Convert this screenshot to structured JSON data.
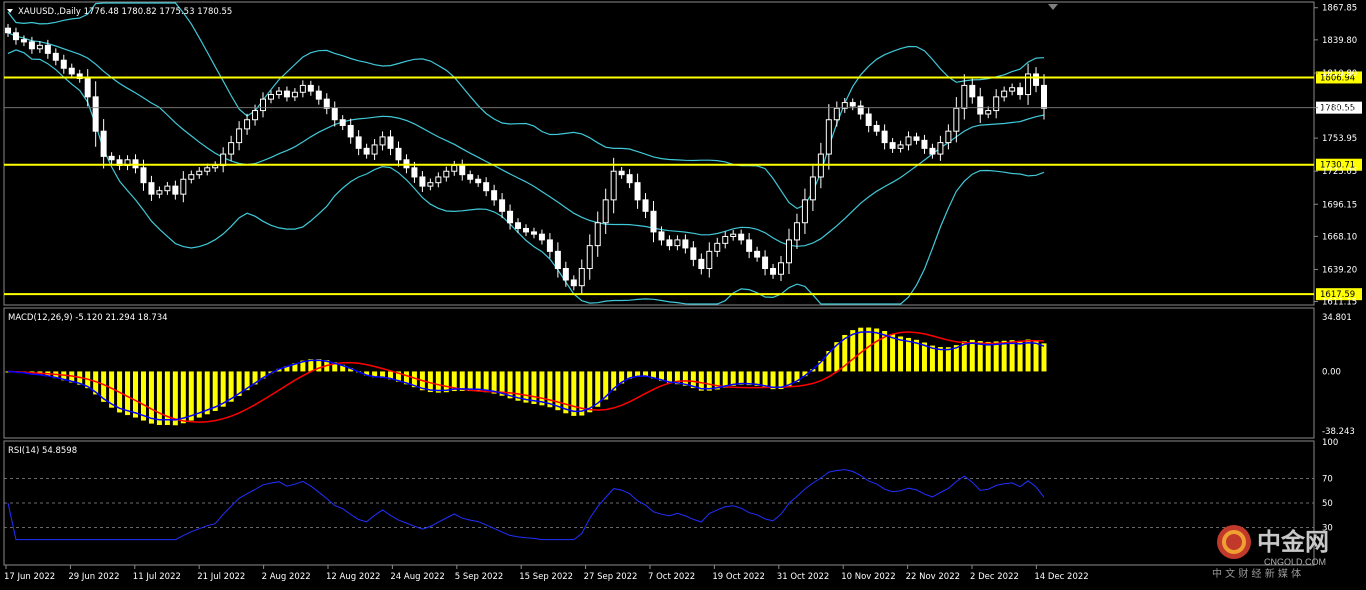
{
  "header": {
    "main_title": "XAUUSD.,Daily  1776.48 1780.82 1775.53 1780.55",
    "macd_title": "MACD(12,26,9) -5.120 21.294 18.734",
    "rsi_title": "RSI(14) 54.8598"
  },
  "colors": {
    "background": "#000000",
    "candle": "#ffffff",
    "bollinger": "#40c8d8",
    "hline": "#ffff00",
    "macd_hist": "#ffff00",
    "macd_main": "#0000ff",
    "macd_signal": "#ff0000",
    "rsi_line": "#2030ff"
  },
  "price_axis": {
    "ticks": [
      "1867.85",
      "1839.80",
      "1810.80",
      "1780.55",
      "1753.95",
      "1725.05",
      "1696.15",
      "1668.10",
      "1639.20",
      "1611.15"
    ],
    "tick_values": [
      1867.85,
      1839.8,
      1810.8,
      1780.55,
      1753.95,
      1725.05,
      1696.15,
      1668.1,
      1639.2,
      1611.15
    ],
    "range": [
      1609,
      1872
    ]
  },
  "horizontal_levels": [
    {
      "label": "1806.94",
      "value": 1806.94
    },
    {
      "label": "1730.71",
      "value": 1730.71
    },
    {
      "label": "1617.59",
      "value": 1617.59
    }
  ],
  "current_price": {
    "label": "1780.55",
    "value": 1780.55
  },
  "macd_axis": {
    "ticks": [
      "34.801",
      "0.00",
      "-38.243"
    ],
    "tick_values": [
      34.801,
      0,
      -38.243
    ]
  },
  "rsi_axis": {
    "ticks": [
      "100",
      "70",
      "50",
      "30"
    ],
    "tick_values": [
      100,
      70,
      50,
      30
    ]
  },
  "time_axis": {
    "labels": [
      "17 Jun 2022",
      "29 Jun 2022",
      "11 Jul 2022",
      "21 Jul 2022",
      "2 Aug 2022",
      "12 Aug 2022",
      "24 Aug 2022",
      "5 Sep 2022",
      "15 Sep 2022",
      "27 Sep 2022",
      "7 Oct 2022",
      "19 Oct 2022",
      "31 Oct 2022",
      "10 Nov 2022",
      "22 Nov 2022",
      "2 Dec 2022",
      "14 Dec 2022"
    ]
  },
  "watermark": {
    "brand": "中金网",
    "site": "CNGOLD.COM",
    "slogan": "中 文 财 经 新 媒 体"
  },
  "chart_data": {
    "type": "candlestick",
    "symbol": "XAUUSD.",
    "timeframe": "Daily",
    "close": [
      1846,
      1840,
      1838,
      1832,
      1835,
      1828,
      1822,
      1815,
      1810,
      1806,
      1790,
      1760,
      1738,
      1735,
      1730,
      1735,
      1728,
      1715,
      1705,
      1708,
      1712,
      1705,
      1718,
      1722,
      1725,
      1728,
      1730,
      1740,
      1750,
      1762,
      1770,
      1778,
      1788,
      1792,
      1795,
      1790,
      1794,
      1800,
      1795,
      1788,
      1780,
      1770,
      1765,
      1755,
      1745,
      1740,
      1748,
      1755,
      1745,
      1735,
      1728,
      1720,
      1712,
      1715,
      1720,
      1725,
      1730,
      1722,
      1718,
      1715,
      1708,
      1700,
      1690,
      1680,
      1675,
      1672,
      1670,
      1665,
      1655,
      1640,
      1630,
      1625,
      1640,
      1660,
      1680,
      1700,
      1725,
      1722,
      1715,
      1700,
      1690,
      1672,
      1665,
      1660,
      1665,
      1658,
      1648,
      1640,
      1655,
      1662,
      1668,
      1670,
      1665,
      1655,
      1650,
      1640,
      1635,
      1645,
      1665,
      1680,
      1700,
      1720,
      1740,
      1770,
      1780,
      1785,
      1782,
      1775,
      1765,
      1760,
      1750,
      1745,
      1748,
      1755,
      1752,
      1745,
      1740,
      1750,
      1760,
      1780,
      1800,
      1790,
      1775,
      1778,
      1790,
      1795,
      1798,
      1792,
      1810,
      1800,
      1780
    ]
  }
}
